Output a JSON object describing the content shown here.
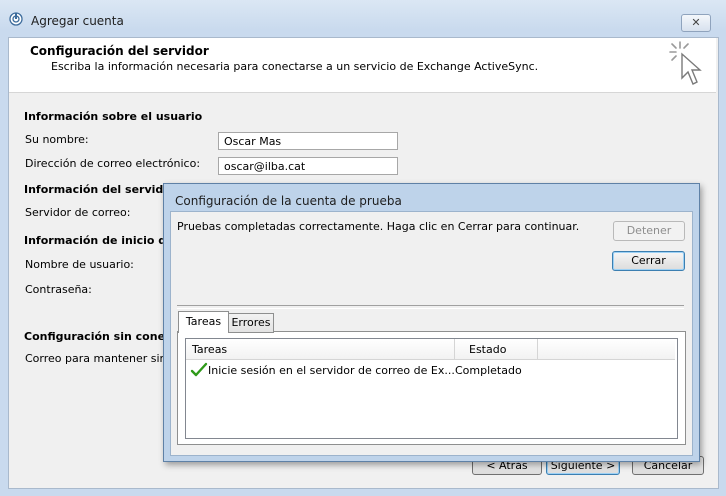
{
  "window": {
    "title": "Agregar cuenta",
    "close_glyph": "✕"
  },
  "header": {
    "title": "Configuración del servidor",
    "subtitle": "Escriba la información necesaria para conectarse a un servicio de Exchange ActiveSync."
  },
  "form": {
    "user_section": "Información sobre el usuario",
    "name_label": "Su nombre:",
    "name_value": "Oscar Mas",
    "email_label": "Dirección de correo electrónico:",
    "email_value": "oscar@ilba.cat",
    "server_section": "Información del servidor",
    "mail_server_label": "Servidor de correo:",
    "logon_section": "Información de inicio de se",
    "username_label": "Nombre de usuario:",
    "password_label": "Contraseña:",
    "offline_section": "Configuración sin conexión",
    "offline_label": "Correo para mantener sin c"
  },
  "buttons": {
    "back": "< Atrás",
    "next": "Siguiente >",
    "cancel": "Cancelar"
  },
  "test_dialog": {
    "title": "Configuración de la cuenta de prueba",
    "status": "Pruebas completadas correctamente. Haga clic en Cerrar para continuar.",
    "stop_button": "Detener",
    "close_button": "Cerrar",
    "tabs": [
      "Tareas",
      "Errores"
    ],
    "columns": [
      "Tareas",
      "Estado"
    ],
    "rows": [
      {
        "task": "Inicie sesión en el servidor de correo de Ex...",
        "status": "Completado",
        "icon": "check-icon"
      }
    ]
  },
  "colors": {
    "accent": "#3c7fb1",
    "check": "#2f9a1a"
  }
}
